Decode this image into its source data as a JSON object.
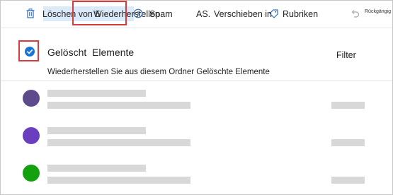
{
  "toolbar": {
    "delete_label": "Löschen von 5",
    "restore_label": "Wiederherstellen",
    "spam_label": "Spam",
    "as_label": "AS.",
    "move_label": "Verschieben in",
    "categories_label": "Rubriken",
    "undo_label": "Rückgängig",
    "icons": {
      "delete": "trash-icon",
      "spam": "spam-icon",
      "categories": "tag-icon",
      "undo": "undo-icon"
    }
  },
  "folder": {
    "title": "Gelöscht  Elemente",
    "filter_label": "Filter",
    "info_text": "Wiederherstellen Sie aus diesem Ordner Gelöschte Elemente",
    "selected": true
  },
  "colors": {
    "accent": "#1a73d8",
    "highlight": "#dce9f8",
    "annotation": "#d83b3b",
    "placeholder": "#d8d8d8"
  },
  "messages": [
    {
      "avatar_color": "#5e4b8b"
    },
    {
      "avatar_color": "#6a3fbf"
    },
    {
      "avatar_color": "#13a10e"
    }
  ]
}
